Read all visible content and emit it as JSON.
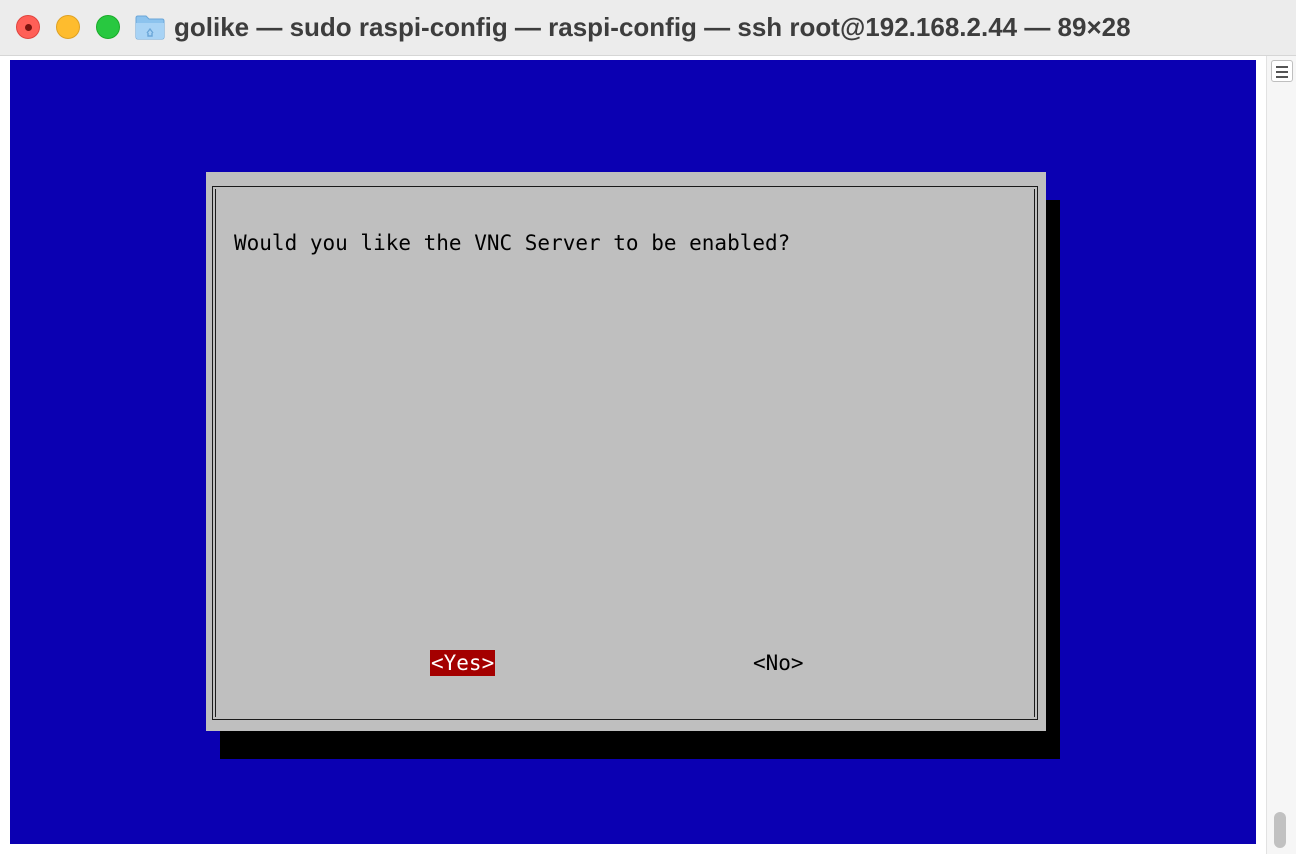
{
  "window": {
    "title": "golike — sudo raspi-config — raspi-config — ssh root@192.168.2.44 — 89×28"
  },
  "dialog": {
    "message": "Would you like the VNC Server to be enabled?",
    "yes_label": "<Yes>",
    "no_label": "<No>",
    "selected": "yes"
  },
  "colors": {
    "terminal_background": "#0b00b2",
    "dialog_background": "#bfbfbf",
    "selected_button": "#a40000"
  },
  "icons": {
    "title_folder": "folder-icon",
    "split_view": "split-view-icon"
  }
}
